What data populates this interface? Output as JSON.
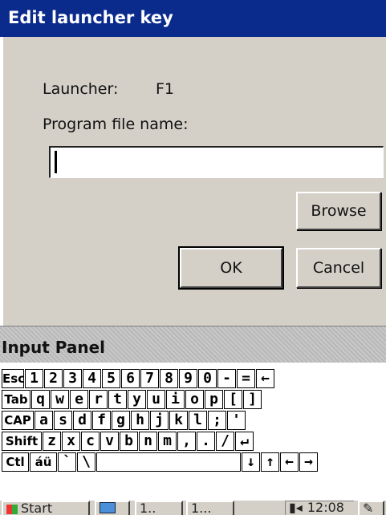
{
  "dialog": {
    "title": "Edit launcher key",
    "launcher_label": "Launcher:",
    "launcher_value": "F1",
    "program_label": "Program file name:",
    "program_value": "",
    "browse_label": "Browse",
    "ok_label": "OK",
    "cancel_label": "Cancel"
  },
  "input_panel": {
    "title": "Input Panel",
    "rows": [
      [
        "Esc",
        "1",
        "2",
        "3",
        "4",
        "5",
        "6",
        "7",
        "8",
        "9",
        "0",
        "-",
        "=",
        "←"
      ],
      [
        "Tab",
        "q",
        "w",
        "e",
        "r",
        "t",
        "y",
        "u",
        "i",
        "o",
        "p",
        "[",
        "]"
      ],
      [
        "CAP",
        "a",
        "s",
        "d",
        "f",
        "g",
        "h",
        "j",
        "k",
        "l",
        ";",
        "'"
      ],
      [
        "Shift",
        "z",
        "x",
        "c",
        "v",
        "b",
        "n",
        "m",
        ",",
        ".",
        "/",
        "↵"
      ],
      [
        "Ctl",
        "áü",
        "`",
        "\\",
        " ",
        "↓",
        "↑",
        "←",
        "→"
      ]
    ]
  },
  "taskbar": {
    "start_label": "Start",
    "task1_label": "1..",
    "task2_label": "1...",
    "clock": "12:08 PM"
  },
  "colors": {
    "titlebar": "#0a2a8c",
    "dialog_bg": "#d4d0c8"
  }
}
